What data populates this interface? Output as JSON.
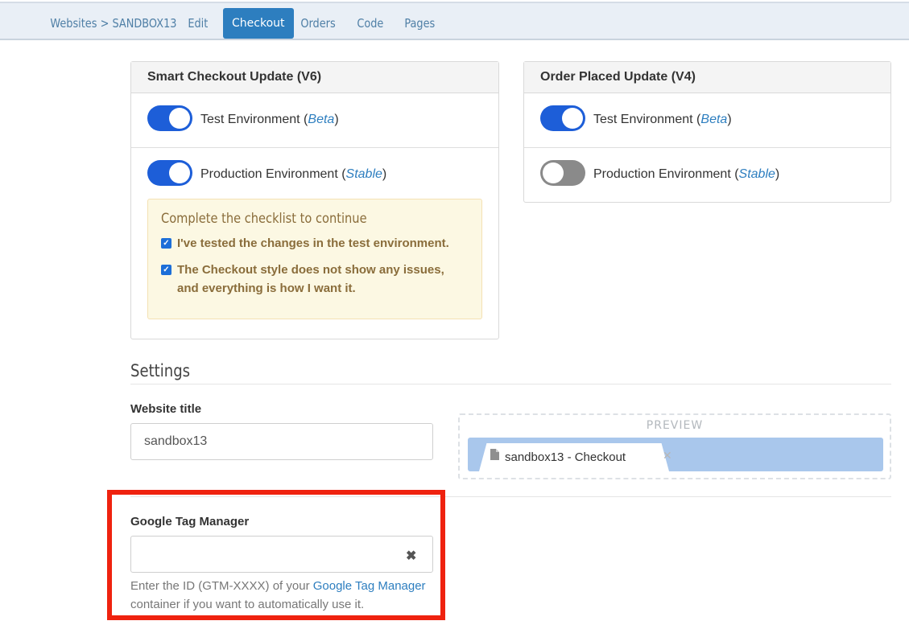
{
  "nav": {
    "breadcrumb": "Websites > SANDBOX13",
    "tabs": [
      "Edit",
      "Checkout",
      "Orders",
      "Code",
      "Pages"
    ],
    "active_tab": "Checkout"
  },
  "smart_checkout": {
    "title": "Smart Checkout Update (V6)",
    "test_env": {
      "label": "Test Environment (",
      "tag": "Beta",
      "close": ")",
      "enabled": true
    },
    "prod_env": {
      "label": "Production Environment (",
      "tag": "Stable",
      "close": ")",
      "enabled": true
    },
    "checklist": {
      "title": "Complete the checklist to continue",
      "items": [
        {
          "text": "I've tested the changes in the test environment.",
          "checked": true
        },
        {
          "text": "The Checkout style does not show any issues, and everything is how I want it.",
          "checked": true
        }
      ]
    }
  },
  "order_placed": {
    "title": "Order Placed Update (V4)",
    "test_env": {
      "label": "Test Environment (",
      "tag": "Beta",
      "close": ")",
      "enabled": true
    },
    "prod_env": {
      "label": "Production Environment (",
      "tag": "Stable",
      "close": ")",
      "enabled": false
    }
  },
  "settings": {
    "title": "Settings",
    "website_title_label": "Website title",
    "website_title_value": "sandbox13",
    "preview_label": "PREVIEW",
    "preview_tab_text": "sandbox13 - Checkout",
    "gtm_label": "Google Tag Manager",
    "gtm_value": "",
    "gtm_help_before": "Enter the ID (GTM-XXXX) of your ",
    "gtm_help_link": "Google Tag Manager",
    "gtm_help_after": " container if you want to automatically use it."
  },
  "colors": {
    "accent": "#2d7ebf",
    "toggle_on": "#1d5ed8",
    "toggle_off": "#8a8a8a",
    "highlight": "#ef220f",
    "warning_bg": "#fcf8e3"
  },
  "icons": {
    "checkbox": "check-icon",
    "clear": "close-icon",
    "document": "document-icon"
  }
}
